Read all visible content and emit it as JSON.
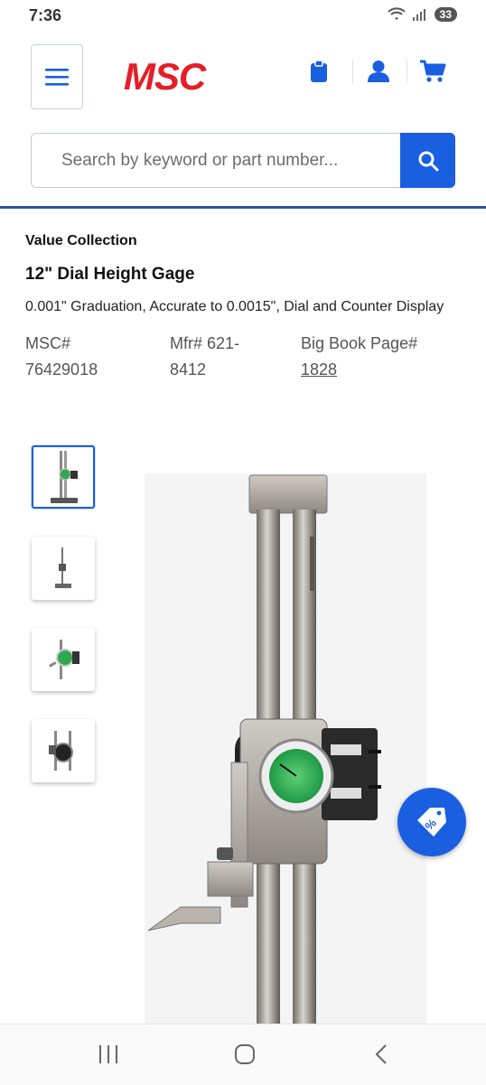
{
  "status": {
    "time": "7:36",
    "battery": "33"
  },
  "header": {
    "logo_text": "MSC",
    "brand_color": "#e41e26",
    "accent_color": "#1a5fe0",
    "icons": [
      "menu-icon",
      "clipboard-icon",
      "account-icon",
      "cart-icon"
    ]
  },
  "search": {
    "placeholder": "Search by keyword or part number..."
  },
  "product": {
    "brand": "Value Collection",
    "title": "12\" Dial Height Gage",
    "description": "0.001\" Graduation, Accurate to 0.0015\", Dial and Counter Display",
    "msc_label": "MSC#",
    "msc_value": "76429018",
    "mfr_label": "Mfr# 621-",
    "mfr_value": "8412",
    "bigbook_label": "Big Book Page#",
    "bigbook_value": "1828"
  },
  "gallery": {
    "thumbnail_count": 4,
    "active_thumbnail": 1
  },
  "promo": {
    "icon": "discount-tag-icon"
  },
  "navbar": {
    "icons": [
      "recent-apps-icon",
      "home-icon",
      "back-icon"
    ]
  }
}
